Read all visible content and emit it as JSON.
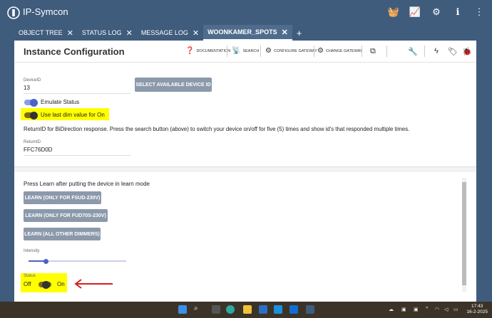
{
  "app": {
    "title": "IP-Symcon"
  },
  "top_icons": [
    {
      "name": "basket-icon",
      "glyph": "🧺"
    },
    {
      "name": "chart-line-icon",
      "glyph": "📈"
    },
    {
      "name": "gear-icon",
      "glyph": "⚙"
    },
    {
      "name": "info-icon",
      "glyph": "ℹ"
    },
    {
      "name": "more-vertical-icon",
      "glyph": "⋮"
    }
  ],
  "tabs": [
    {
      "label": "OBJECT TREE",
      "close": "✕"
    },
    {
      "label": "STATUS LOG",
      "close": "✕"
    },
    {
      "label": "MESSAGE LOG",
      "close": "✕"
    },
    {
      "label": "WOONKAMER_SPOTS",
      "close": "✕"
    }
  ],
  "tab_add": "+",
  "header": {
    "title": "Instance Configuration",
    "documentation": "DOCUMENTATION",
    "search": "SEARCH",
    "configure_gateway": "CONFIGURE GATEWAY",
    "change_gateway": "CHANGE GATEWAY"
  },
  "config": {
    "device_id_label": "DeviceID",
    "device_id_value": "13",
    "select_device_btn": "SELECT AVAILABLE DEVICE ID",
    "emulate_status_label": "Emulate Status",
    "emulate_status_on": true,
    "last_dim_label": "Use last dim value for On",
    "last_dim_on": true,
    "returnid_desc": "ReturnID for BiDirection response. Press the search button (above) to switch your device on/off for five (5) times and show id's that responded multiple times.",
    "return_id_label": "ReturnID",
    "return_id_value": "FFC76D0D"
  },
  "actions": {
    "learn_text": "Press Learn after putting the device in learn mode",
    "learn_fsud": "LEARN (ONLY FOR FSUD-230V)",
    "learn_fud70s": "LEARN (ONLY FOR FUD70S-230V)",
    "learn_all": "LEARN (ALL OTHER DIMMERS)",
    "intensity_label": "Intensity",
    "intensity_value": 0.18,
    "status_label": "Status",
    "status_off": "Off",
    "status_on": "On",
    "status_state": false
  },
  "colors": {
    "brand": "#3f5c7d",
    "button": "#8b99ab",
    "accent": "#4a63c7",
    "highlight": "#ffff00",
    "arrow": "#d42020"
  },
  "taskbar": {
    "time": "17:43",
    "date": "16-2-2025"
  }
}
